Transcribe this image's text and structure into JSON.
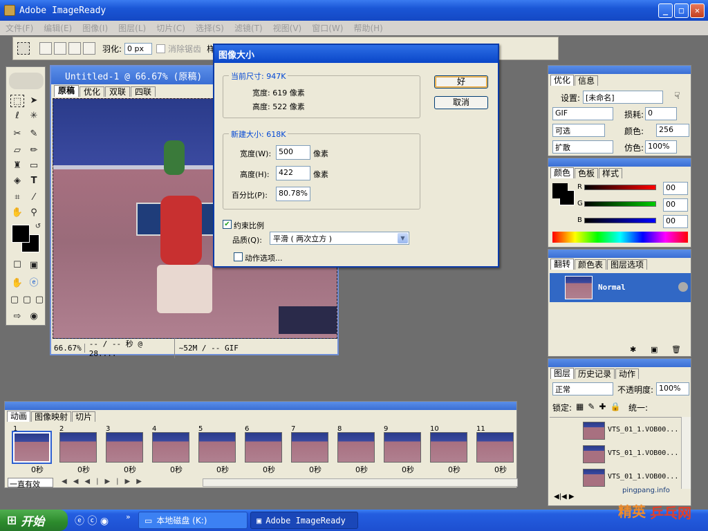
{
  "window": {
    "title": "Adobe ImageReady",
    "min": "_",
    "max": "□",
    "close": "✕"
  },
  "menu": [
    "文件(F)",
    "编辑(E)",
    "图像(I)",
    "图层(L)",
    "切片(C)",
    "选择(S)",
    "滤镜(T)",
    "视图(V)",
    "窗口(W)",
    "帮助(H)"
  ],
  "options": {
    "feather_label": "羽化:",
    "feather_value": "0 px",
    "antialias_label": "消除锯齿",
    "style_label": "样式"
  },
  "document": {
    "title": "Untitled-1 @ 66.67% (原稿)",
    "tabs": [
      "原稿",
      "优化",
      "双联",
      "四联"
    ],
    "status_zoom": "66.67%",
    "status_time": "-- / -- 秒 @ 28....",
    "status_size": "~52M / -- GIF"
  },
  "dialog": {
    "title": "图像大小",
    "current_label": "当前尺寸: 947K",
    "cur_width": "宽度: 619 像素",
    "cur_height": "高度: 522 像素",
    "new_label": "新建大小: 618K",
    "width_label": "宽度(W):",
    "width_value": "500",
    "height_label": "高度(H):",
    "height_value": "422",
    "percent_label": "百分比(P):",
    "percent_value": "80.78%",
    "unit": "像素",
    "ok": "好",
    "cancel": "取消",
    "constrain": "约束比例",
    "quality_label": "品质(Q):",
    "quality_value": "平滑 ( 两次立方 )",
    "action_options": "动作选项..."
  },
  "optimize": {
    "tabs": [
      "优化",
      "信息"
    ],
    "settings_label": "设置:",
    "settings_value": "[未命名]",
    "format": "GIF",
    "lossy_label": "损耗:",
    "lossy_value": "0",
    "palette": "可选",
    "colors_label": "颜色:",
    "colors_value": "256",
    "dither": "扩散",
    "dither_amt_label": "仿色:",
    "dither_amt_value": "100%"
  },
  "color": {
    "tabs": [
      "颜色",
      "色板",
      "样式"
    ],
    "r_label": "R",
    "r_value": "00",
    "g_label": "G",
    "g_value": "00",
    "b_label": "B",
    "b_value": "00"
  },
  "rollover": {
    "tabs": [
      "翻转",
      "颜色表",
      "图层选项"
    ],
    "state": "Normal"
  },
  "layers": {
    "tabs": [
      "图层",
      "历史记录",
      "动作"
    ],
    "blend": "正常",
    "opacity_label": "不透明度:",
    "opacity_value": "100%",
    "lock_label": "锁定:",
    "unify_label": "统一:",
    "items": [
      "VTS_01_1.VOB00...",
      "VTS_01_1.VOB00...",
      "VTS_01_1.VOB00..."
    ]
  },
  "animation": {
    "tabs": [
      "动画",
      "图像映射",
      "切片"
    ],
    "frames": [
      "1",
      "2",
      "3",
      "4",
      "5",
      "6",
      "7",
      "8",
      "9",
      "10",
      "11"
    ],
    "delay": "0秒",
    "loop": "一直有效"
  },
  "taskbar": {
    "start": "开始",
    "tasks": [
      "本地磁盘 (K:)",
      "Adobe ImageReady"
    ],
    "watermark_url": "pingpang.info",
    "watermark_text": "乒乓网",
    "watermark_prefix": "精英"
  },
  "colors": {
    "xp_blue": "#245ee0",
    "dialog_blue": "#0046d5",
    "start_green": "#2c8a2c"
  }
}
